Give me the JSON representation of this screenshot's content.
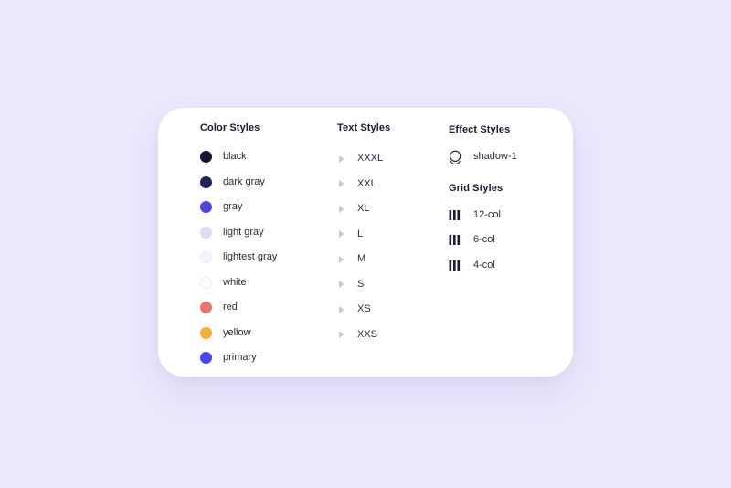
{
  "canvas": {
    "background_color": "#ebe9fd",
    "card_background_color": "#ffffff"
  },
  "card": {
    "columns": {
      "color": {
        "heading": "Color Styles",
        "items": [
          {
            "label": "black",
            "color": "#161636",
            "outlined": false
          },
          {
            "label": "dark gray",
            "color": "#22225c",
            "outlined": false
          },
          {
            "label": "gray",
            "color": "#4f46d8",
            "outlined": false
          },
          {
            "label": "light gray",
            "color": "#dedcfa",
            "outlined": false
          },
          {
            "label": "lightest gray",
            "color": "#f5f4fd",
            "outlined": true
          },
          {
            "label": "white",
            "color": "#ffffff",
            "outlined": true
          },
          {
            "label": "red",
            "color": "#e8766f",
            "outlined": false
          },
          {
            "label": "yellow",
            "color": "#f5ad3c",
            "outlined": false
          },
          {
            "label": "primary",
            "color": "#4b45f0",
            "outlined": false
          }
        ]
      },
      "text": {
        "heading": "Text Styles",
        "caret_icon": "caret-right-icon",
        "items": [
          {
            "label": "XXXL"
          },
          {
            "label": "XXL"
          },
          {
            "label": "XL"
          },
          {
            "label": "L"
          },
          {
            "label": "M"
          },
          {
            "label": "S"
          },
          {
            "label": "XS"
          },
          {
            "label": "XXS"
          }
        ]
      },
      "effect": {
        "heading": "Effect Styles",
        "items": [
          {
            "label": "shadow-1",
            "icon": "shadow-circle-icon"
          }
        ]
      },
      "grid": {
        "heading": "Grid Styles",
        "items": [
          {
            "label": "12-col",
            "icon": "grid-columns-icon"
          },
          {
            "label": "6-col",
            "icon": "grid-columns-icon"
          },
          {
            "label": "4-col",
            "icon": "grid-columns-icon"
          }
        ]
      }
    }
  }
}
